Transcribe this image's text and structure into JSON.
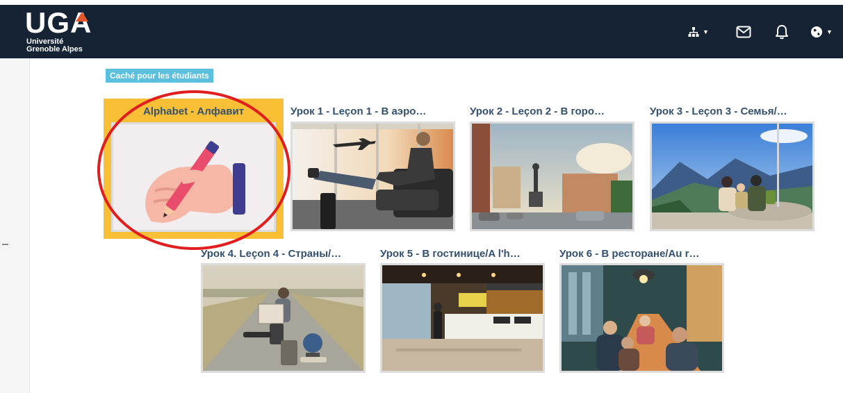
{
  "header": {
    "logo_letters": "UGA",
    "logo_line1": "Université",
    "logo_line2": "Grenoble Alpes",
    "icons": [
      "sitemap-icon",
      "mail-icon",
      "bell-icon",
      "globe-icon"
    ]
  },
  "badge": {
    "label": "Caché pour les étudiants"
  },
  "tiles": [
    {
      "title": "Alphabet - Алфавит",
      "image": "writing-hand-illustration"
    },
    {
      "title": "Урок 1 - Leçon 1 - В аэро…",
      "image": "airport-lounge-photo"
    },
    {
      "title": "Урок 2 - Leçon 2 - В горо…",
      "image": "city-square-photo"
    },
    {
      "title": "Урок 3 - Leçon 3 - Семья/…",
      "image": "mountain-family-photo"
    },
    {
      "title": "Урок 4. Leçon 4 - Страны/…",
      "image": "road-traveler-photo"
    },
    {
      "title": "Урок 5 - В гостинице/A l'h…",
      "image": "hotel-lobby-photo"
    },
    {
      "title": "Урок 6 - В ресторане/Au r…",
      "image": "restaurant-photo"
    }
  ],
  "colors": {
    "topbar": "#152334",
    "accent_orange": "#e4572e",
    "highlight": "#f9bf35",
    "badge": "#5bc0de",
    "title_text": "#33506e",
    "annotation": "#e11d1d"
  }
}
